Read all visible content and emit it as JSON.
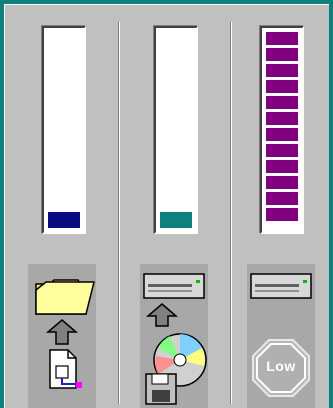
{
  "meters": [
    {
      "name": "save-to-disk",
      "level": 0.08,
      "fill_color": "#0a0a80",
      "segmented": false
    },
    {
      "name": "write-to-cd",
      "level": 0.08,
      "fill_color": "#0f8080",
      "segmented": false
    },
    {
      "name": "cache-buffer",
      "level": 1.0,
      "fill_color": "#800080",
      "segmented": true
    }
  ],
  "icons": {
    "col1": [
      "folder-icon",
      "up-arrow-icon",
      "document-icon"
    ],
    "col2": [
      "drive-icon",
      "up-arrow-icon",
      "cd-disc-icon"
    ],
    "col3": [
      "drive-icon",
      "low-stop-sign-icon"
    ]
  },
  "status": {
    "low_label": "Low"
  },
  "colors": {
    "background": "#0f8080",
    "panel": "#c0c0c0",
    "tile": "#a8a8a8"
  }
}
